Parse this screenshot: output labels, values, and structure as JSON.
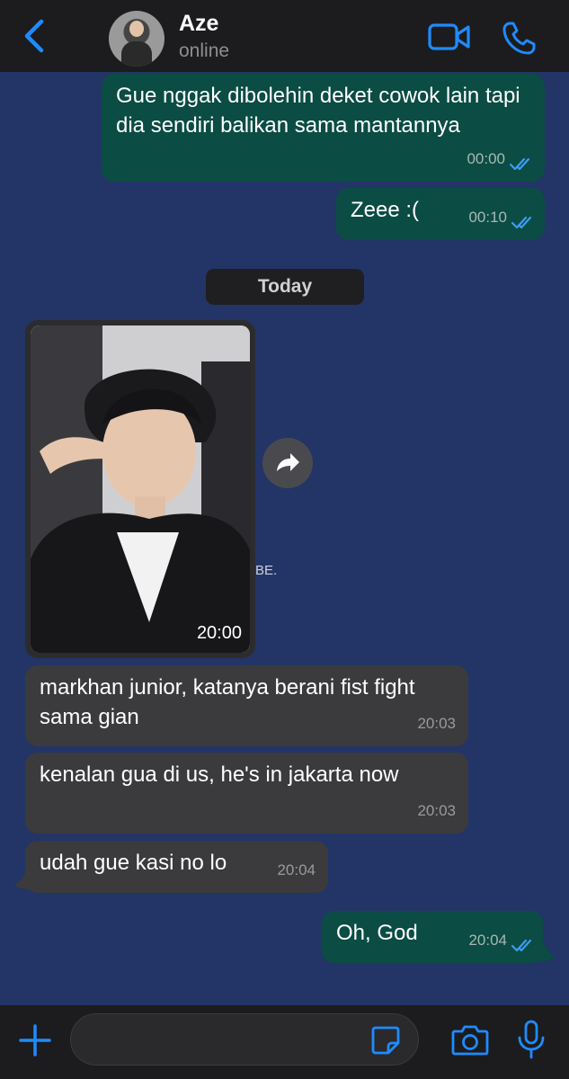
{
  "header": {
    "contact_name": "Aze",
    "contact_status": "online"
  },
  "messages": [
    {
      "direction": "outgoing",
      "text": "Gue nggak dibolehin deket cowok lain tapi dia sendiri balikan sama mantannya",
      "time": "00:00",
      "status": "read"
    },
    {
      "direction": "outgoing",
      "text": "Zeee :(",
      "time": "00:10",
      "status": "read"
    },
    {
      "type": "date-separator",
      "text": "Today"
    },
    {
      "direction": "incoming",
      "type": "photo",
      "time": "20:00",
      "background_fragment": "BE."
    },
    {
      "direction": "incoming",
      "text": "markhan junior, katanya berani fist fight sama gian",
      "time": "20:03"
    },
    {
      "direction": "incoming",
      "text": "kenalan gua di us, he's in jakarta now",
      "time": "20:03"
    },
    {
      "direction": "incoming",
      "text": "udah gue kasi no lo",
      "time": "20:04"
    },
    {
      "direction": "outgoing",
      "text": "Oh, God",
      "time": "20:04",
      "status": "read"
    }
  ],
  "composer": {
    "value": "",
    "placeholder": ""
  },
  "icons": {
    "back": "chevron-left-icon",
    "video": "video-camera-icon",
    "call": "phone-icon",
    "forward": "forward-arrow-icon",
    "attach": "plus-icon",
    "sticker": "sticker-icon",
    "camera": "camera-icon",
    "mic": "microphone-icon"
  },
  "colors": {
    "accent": "#1e8cff",
    "chat_background": "#233566",
    "outgoing_bubble": "#0b4c44",
    "incoming_bubble": "#3b3b3d",
    "read_ticks": "#3e9bf0"
  }
}
